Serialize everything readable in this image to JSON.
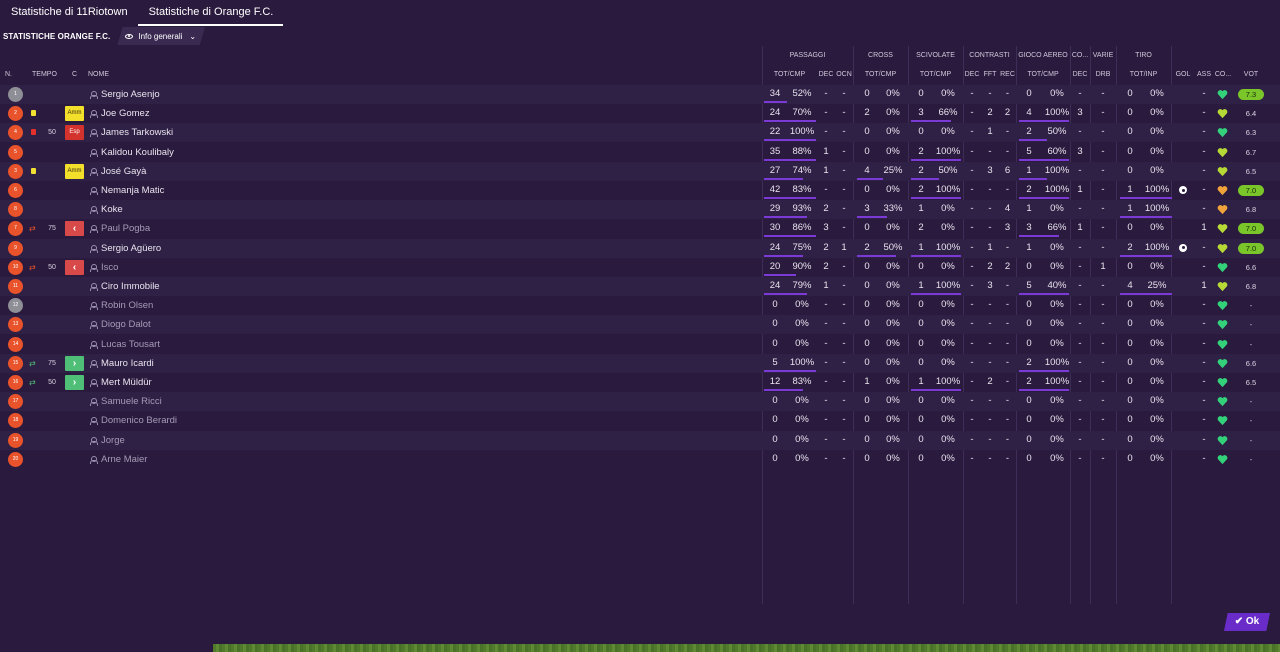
{
  "tabs": [
    "Statistiche di 11Riotown",
    "Statistiche di Orange F.C."
  ],
  "title": "STATISTICHE ORANGE F.C.",
  "view_dropdown": "Info generali",
  "groups": [
    {
      "label": "PASSAGGI"
    },
    {
      "label": "CROSS"
    },
    {
      "label": "SCIVOLATE"
    },
    {
      "label": "CONTRASTI"
    },
    {
      "label": "GIOCO AEREO"
    },
    {
      "label": "CO..."
    },
    {
      "label": "VARIE"
    },
    {
      "label": "TIRO"
    }
  ],
  "left_headers": {
    "n": "N.",
    "tempo": "TEMPO",
    "c": "C",
    "nome": "NOME"
  },
  "subheaders": [
    "TOT/CMP",
    "DEC",
    "OCN",
    "TOT/CMP",
    "TOT/CMP",
    "DEC",
    "FFT",
    "REC",
    "TOT/CMP",
    "DEC",
    "DRB",
    "TOT/INP",
    "GOL",
    "ASS",
    "CO...",
    "VOT"
  ],
  "ok_label": "✔ Ok",
  "players": [
    {
      "num": "1",
      "gk": true,
      "card": "",
      "sub": "",
      "min": "",
      "badge": "",
      "badge_label": "",
      "name": "Sergio Asenjo",
      "dim": false,
      "pt": "34",
      "pp": "52%",
      "pb": 45,
      "pdec": "-",
      "pocn": "-",
      "ct": "0",
      "cp": "0%",
      "cb": 0,
      "st": "0",
      "sp": "0%",
      "sb": 0,
      "tdec": "-",
      "tfft": "-",
      "trec": "-",
      "at": "0",
      "ap": "0%",
      "ab": 0,
      "co": "-",
      "drb": "-",
      "sht": "0",
      "shp": "0%",
      "shb": 0,
      "gol": "",
      "ass": "-",
      "heart": "g",
      "vot": "7.3",
      "vhi": true
    },
    {
      "num": "2",
      "gk": false,
      "card": "y",
      "sub": "",
      "min": "",
      "badge": "amm",
      "badge_label": "Amm",
      "name": "Joe Gomez",
      "dim": false,
      "pt": "24",
      "pp": "70%",
      "pb": 100,
      "pdec": "-",
      "pocn": "-",
      "ct": "2",
      "cp": "0%",
      "cb": 0,
      "st": "3",
      "sp": "66%",
      "sb": 80,
      "tdec": "-",
      "tfft": "2",
      "trec": "2",
      "at": "4",
      "ap": "100%",
      "ab": 100,
      "co": "3",
      "drb": "-",
      "sht": "0",
      "shp": "0%",
      "shb": 0,
      "gol": "",
      "ass": "-",
      "heart": "y",
      "vot": "6.4",
      "vhi": false
    },
    {
      "num": "4",
      "gk": false,
      "card": "r",
      "sub": "",
      "min": "50",
      "badge": "esp",
      "badge_label": "Esp",
      "name": "James Tarkowski",
      "dim": false,
      "pt": "22",
      "pp": "100%",
      "pb": 100,
      "pdec": "-",
      "pocn": "-",
      "ct": "0",
      "cp": "0%",
      "cb": 0,
      "st": "0",
      "sp": "0%",
      "sb": 0,
      "tdec": "-",
      "tfft": "1",
      "trec": "-",
      "at": "2",
      "ap": "50%",
      "ab": 55,
      "co": "-",
      "drb": "-",
      "sht": "0",
      "shp": "0%",
      "shb": 0,
      "gol": "",
      "ass": "-",
      "heart": "g",
      "vot": "6.3",
      "vhi": false
    },
    {
      "num": "5",
      "gk": false,
      "card": "",
      "sub": "",
      "min": "",
      "badge": "",
      "badge_label": "",
      "name": "Kalidou Koulibaly",
      "dim": false,
      "pt": "35",
      "pp": "88%",
      "pb": 100,
      "pdec": "1",
      "pocn": "-",
      "ct": "0",
      "cp": "0%",
      "cb": 0,
      "st": "2",
      "sp": "100%",
      "sb": 100,
      "tdec": "-",
      "tfft": "-",
      "trec": "-",
      "at": "5",
      "ap": "60%",
      "ab": 100,
      "co": "3",
      "drb": "-",
      "sht": "0",
      "shp": "0%",
      "shb": 0,
      "gol": "",
      "ass": "-",
      "heart": "y",
      "vot": "6.7",
      "vhi": false
    },
    {
      "num": "3",
      "gk": false,
      "card": "y",
      "sub": "",
      "min": "",
      "badge": "amm",
      "badge_label": "Amm",
      "name": "José Gayà",
      "dim": false,
      "pt": "27",
      "pp": "74%",
      "pb": 75,
      "pdec": "1",
      "pocn": "-",
      "ct": "4",
      "cp": "25%",
      "cb": 55,
      "st": "2",
      "sp": "50%",
      "sb": 55,
      "tdec": "-",
      "tfft": "3",
      "trec": "6",
      "at": "1",
      "ap": "100%",
      "ab": 55,
      "co": "-",
      "drb": "-",
      "sht": "0",
      "shp": "0%",
      "shb": 0,
      "gol": "",
      "ass": "-",
      "heart": "y",
      "vot": "6.5",
      "vhi": false
    },
    {
      "num": "6",
      "gk": false,
      "card": "",
      "sub": "",
      "min": "",
      "badge": "",
      "badge_label": "",
      "name": "Nemanja Matic",
      "dim": false,
      "pt": "42",
      "pp": "83%",
      "pb": 100,
      "pdec": "-",
      "pocn": "-",
      "ct": "0",
      "cp": "0%",
      "cb": 0,
      "st": "2",
      "sp": "100%",
      "sb": 100,
      "tdec": "-",
      "tfft": "-",
      "trec": "-",
      "at": "2",
      "ap": "100%",
      "ab": 100,
      "co": "1",
      "drb": "-",
      "sht": "1",
      "shp": "100%",
      "shb": 100,
      "gol": "ball",
      "ass": "-",
      "heart": "o",
      "vot": "7.0",
      "vhi": true
    },
    {
      "num": "8",
      "gk": false,
      "card": "",
      "sub": "",
      "min": "",
      "badge": "",
      "badge_label": "",
      "name": "Koke",
      "dim": false,
      "pt": "29",
      "pp": "93%",
      "pb": 82,
      "pdec": "2",
      "pocn": "-",
      "ct": "3",
      "cp": "33%",
      "cb": 62,
      "st": "1",
      "sp": "0%",
      "sb": 0,
      "tdec": "-",
      "tfft": "-",
      "trec": "4",
      "at": "1",
      "ap": "0%",
      "ab": 0,
      "co": "-",
      "drb": "-",
      "sht": "1",
      "shp": "100%",
      "shb": 100,
      "gol": "",
      "ass": "-",
      "heart": "o",
      "vot": "6.8",
      "vhi": false
    },
    {
      "num": "7",
      "gk": false,
      "card": "",
      "sub": "out",
      "min": "75",
      "badge": "out",
      "badge_label": "‹",
      "name": "Paul Pogba",
      "dim": true,
      "pt": "30",
      "pp": "86%",
      "pb": 100,
      "pdec": "3",
      "pocn": "-",
      "ct": "0",
      "cp": "0%",
      "cb": 0,
      "st": "2",
      "sp": "0%",
      "sb": 0,
      "tdec": "-",
      "tfft": "-",
      "trec": "3",
      "at": "3",
      "ap": "66%",
      "ab": 80,
      "co": "1",
      "drb": "-",
      "sht": "0",
      "shp": "0%",
      "shb": 0,
      "gol": "",
      "ass": "1",
      "heart": "y",
      "vot": "7.0",
      "vhi": true
    },
    {
      "num": "9",
      "gk": false,
      "card": "",
      "sub": "",
      "min": "",
      "badge": "",
      "badge_label": "",
      "name": "Sergio Agüero",
      "dim": false,
      "pt": "24",
      "pp": "75%",
      "pb": 75,
      "pdec": "2",
      "pocn": "1",
      "ct": "2",
      "cp": "50%",
      "cb": 82,
      "st": "1",
      "sp": "100%",
      "sb": 100,
      "tdec": "-",
      "tfft": "1",
      "trec": "-",
      "at": "1",
      "ap": "0%",
      "ab": 0,
      "co": "-",
      "drb": "-",
      "sht": "2",
      "shp": "100%",
      "shb": 100,
      "gol": "ball",
      "ass": "-",
      "heart": "y",
      "vot": "7.0",
      "vhi": true
    },
    {
      "num": "10",
      "gk": false,
      "card": "",
      "sub": "out",
      "min": "50",
      "badge": "out",
      "badge_label": "‹",
      "name": "Isco",
      "dim": true,
      "pt": "20",
      "pp": "90%",
      "pb": 62,
      "pdec": "2",
      "pocn": "-",
      "ct": "0",
      "cp": "0%",
      "cb": 0,
      "st": "0",
      "sp": "0%",
      "sb": 0,
      "tdec": "-",
      "tfft": "2",
      "trec": "2",
      "at": "0",
      "ap": "0%",
      "ab": 0,
      "co": "-",
      "drb": "1",
      "sht": "0",
      "shp": "0%",
      "shb": 0,
      "gol": "",
      "ass": "-",
      "heart": "g",
      "vot": "6.6",
      "vhi": false
    },
    {
      "num": "11",
      "gk": false,
      "card": "",
      "sub": "",
      "min": "",
      "badge": "",
      "badge_label": "",
      "name": "Ciro Immobile",
      "dim": false,
      "pt": "24",
      "pp": "79%",
      "pb": 82,
      "pdec": "1",
      "pocn": "-",
      "ct": "0",
      "cp": "0%",
      "cb": 0,
      "st": "1",
      "sp": "100%",
      "sb": 100,
      "tdec": "-",
      "tfft": "3",
      "trec": "-",
      "at": "5",
      "ap": "40%",
      "ab": 100,
      "co": "-",
      "drb": "-",
      "sht": "4",
      "shp": "25%",
      "shb": 100,
      "gol": "",
      "ass": "1",
      "heart": "y",
      "vot": "6.8",
      "vhi": false
    },
    {
      "num": "12",
      "gk": true,
      "card": "",
      "sub": "",
      "min": "",
      "badge": "",
      "badge_label": "",
      "name": "Robin Olsen",
      "dim": true,
      "pt": "0",
      "pp": "0%",
      "pb": 0,
      "pdec": "-",
      "pocn": "-",
      "ct": "0",
      "cp": "0%",
      "cb": 0,
      "st": "0",
      "sp": "0%",
      "sb": 0,
      "tdec": "-",
      "tfft": "-",
      "trec": "-",
      "at": "0",
      "ap": "0%",
      "ab": 0,
      "co": "-",
      "drb": "-",
      "sht": "0",
      "shp": "0%",
      "shb": 0,
      "gol": "",
      "ass": "-",
      "heart": "g",
      "vot": "-",
      "vhi": false
    },
    {
      "num": "13",
      "gk": false,
      "card": "",
      "sub": "",
      "min": "",
      "badge": "",
      "badge_label": "",
      "name": "Diogo Dalot",
      "dim": true,
      "pt": "0",
      "pp": "0%",
      "pb": 0,
      "pdec": "-",
      "pocn": "-",
      "ct": "0",
      "cp": "0%",
      "cb": 0,
      "st": "0",
      "sp": "0%",
      "sb": 0,
      "tdec": "-",
      "tfft": "-",
      "trec": "-",
      "at": "0",
      "ap": "0%",
      "ab": 0,
      "co": "-",
      "drb": "-",
      "sht": "0",
      "shp": "0%",
      "shb": 0,
      "gol": "",
      "ass": "-",
      "heart": "g",
      "vot": "-",
      "vhi": false
    },
    {
      "num": "14",
      "gk": false,
      "card": "",
      "sub": "",
      "min": "",
      "badge": "",
      "badge_label": "",
      "name": "Lucas Tousart",
      "dim": true,
      "pt": "0",
      "pp": "0%",
      "pb": 0,
      "pdec": "-",
      "pocn": "-",
      "ct": "0",
      "cp": "0%",
      "cb": 0,
      "st": "0",
      "sp": "0%",
      "sb": 0,
      "tdec": "-",
      "tfft": "-",
      "trec": "-",
      "at": "0",
      "ap": "0%",
      "ab": 0,
      "co": "-",
      "drb": "-",
      "sht": "0",
      "shp": "0%",
      "shb": 0,
      "gol": "",
      "ass": "-",
      "heart": "g",
      "vot": "-",
      "vhi": false
    },
    {
      "num": "15",
      "gk": false,
      "card": "",
      "sub": "in",
      "min": "75",
      "badge": "in",
      "badge_label": "›",
      "name": "Mauro Icardi",
      "dim": false,
      "pt": "5",
      "pp": "100%",
      "pb": 100,
      "pdec": "-",
      "pocn": "-",
      "ct": "0",
      "cp": "0%",
      "cb": 0,
      "st": "0",
      "sp": "0%",
      "sb": 0,
      "tdec": "-",
      "tfft": "-",
      "trec": "-",
      "at": "2",
      "ap": "100%",
      "ab": 100,
      "co": "-",
      "drb": "-",
      "sht": "0",
      "shp": "0%",
      "shb": 0,
      "gol": "",
      "ass": "-",
      "heart": "g",
      "vot": "6.6",
      "vhi": false
    },
    {
      "num": "16",
      "gk": false,
      "card": "",
      "sub": "in",
      "min": "50",
      "badge": "in",
      "badge_label": "›",
      "name": "Mert Müldür",
      "dim": false,
      "pt": "12",
      "pp": "83%",
      "pb": 75,
      "pdec": "-",
      "pocn": "-",
      "ct": "1",
      "cp": "0%",
      "cb": 0,
      "st": "1",
      "sp": "100%",
      "sb": 100,
      "tdec": "-",
      "tfft": "2",
      "trec": "-",
      "at": "2",
      "ap": "100%",
      "ab": 100,
      "co": "-",
      "drb": "-",
      "sht": "0",
      "shp": "0%",
      "shb": 0,
      "gol": "",
      "ass": "-",
      "heart": "g",
      "vot": "6.5",
      "vhi": false
    },
    {
      "num": "17",
      "gk": false,
      "card": "",
      "sub": "",
      "min": "",
      "badge": "",
      "badge_label": "",
      "name": "Samuele Ricci",
      "dim": true,
      "pt": "0",
      "pp": "0%",
      "pb": 0,
      "pdec": "-",
      "pocn": "-",
      "ct": "0",
      "cp": "0%",
      "cb": 0,
      "st": "0",
      "sp": "0%",
      "sb": 0,
      "tdec": "-",
      "tfft": "-",
      "trec": "-",
      "at": "0",
      "ap": "0%",
      "ab": 0,
      "co": "-",
      "drb": "-",
      "sht": "0",
      "shp": "0%",
      "shb": 0,
      "gol": "",
      "ass": "-",
      "heart": "g",
      "vot": "-",
      "vhi": false
    },
    {
      "num": "18",
      "gk": false,
      "card": "",
      "sub": "",
      "min": "",
      "badge": "",
      "badge_label": "",
      "name": "Domenico Berardi",
      "dim": true,
      "pt": "0",
      "pp": "0%",
      "pb": 0,
      "pdec": "-",
      "pocn": "-",
      "ct": "0",
      "cp": "0%",
      "cb": 0,
      "st": "0",
      "sp": "0%",
      "sb": 0,
      "tdec": "-",
      "tfft": "-",
      "trec": "-",
      "at": "0",
      "ap": "0%",
      "ab": 0,
      "co": "-",
      "drb": "-",
      "sht": "0",
      "shp": "0%",
      "shb": 0,
      "gol": "",
      "ass": "-",
      "heart": "g",
      "vot": "-",
      "vhi": false
    },
    {
      "num": "19",
      "gk": false,
      "card": "",
      "sub": "",
      "min": "",
      "badge": "",
      "badge_label": "",
      "name": "Jorge",
      "dim": true,
      "pt": "0",
      "pp": "0%",
      "pb": 0,
      "pdec": "-",
      "pocn": "-",
      "ct": "0",
      "cp": "0%",
      "cb": 0,
      "st": "0",
      "sp": "0%",
      "sb": 0,
      "tdec": "-",
      "tfft": "-",
      "trec": "-",
      "at": "0",
      "ap": "0%",
      "ab": 0,
      "co": "-",
      "drb": "-",
      "sht": "0",
      "shp": "0%",
      "shb": 0,
      "gol": "",
      "ass": "-",
      "heart": "g",
      "vot": "-",
      "vhi": false
    },
    {
      "num": "20",
      "gk": false,
      "card": "",
      "sub": "",
      "min": "",
      "badge": "",
      "badge_label": "",
      "name": "Arne Maier",
      "dim": true,
      "pt": "0",
      "pp": "0%",
      "pb": 0,
      "pdec": "-",
      "pocn": "-",
      "ct": "0",
      "cp": "0%",
      "cb": 0,
      "st": "0",
      "sp": "0%",
      "sb": 0,
      "tdec": "-",
      "tfft": "-",
      "trec": "-",
      "at": "0",
      "ap": "0%",
      "ab": 0,
      "co": "-",
      "drb": "-",
      "sht": "0",
      "shp": "0%",
      "shb": 0,
      "gol": "",
      "ass": "-",
      "heart": "g",
      "vot": "-",
      "vhi": false
    }
  ]
}
